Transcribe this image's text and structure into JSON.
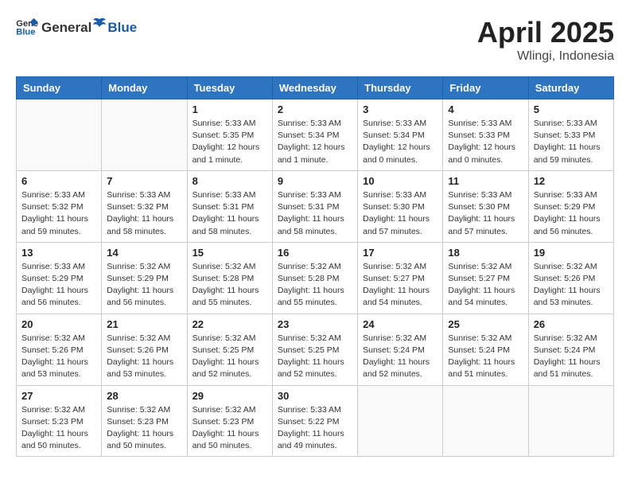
{
  "header": {
    "logo_general": "General",
    "logo_blue": "Blue",
    "title": "April 2025",
    "location": "Wlingi, Indonesia"
  },
  "weekdays": [
    "Sunday",
    "Monday",
    "Tuesday",
    "Wednesday",
    "Thursday",
    "Friday",
    "Saturday"
  ],
  "weeks": [
    [
      {
        "day": "",
        "info": ""
      },
      {
        "day": "",
        "info": ""
      },
      {
        "day": "1",
        "info": "Sunrise: 5:33 AM\nSunset: 5:35 PM\nDaylight: 12 hours\nand 1 minute."
      },
      {
        "day": "2",
        "info": "Sunrise: 5:33 AM\nSunset: 5:34 PM\nDaylight: 12 hours\nand 1 minute."
      },
      {
        "day": "3",
        "info": "Sunrise: 5:33 AM\nSunset: 5:34 PM\nDaylight: 12 hours\nand 0 minutes."
      },
      {
        "day": "4",
        "info": "Sunrise: 5:33 AM\nSunset: 5:33 PM\nDaylight: 12 hours\nand 0 minutes."
      },
      {
        "day": "5",
        "info": "Sunrise: 5:33 AM\nSunset: 5:33 PM\nDaylight: 11 hours\nand 59 minutes."
      }
    ],
    [
      {
        "day": "6",
        "info": "Sunrise: 5:33 AM\nSunset: 5:32 PM\nDaylight: 11 hours\nand 59 minutes."
      },
      {
        "day": "7",
        "info": "Sunrise: 5:33 AM\nSunset: 5:32 PM\nDaylight: 11 hours\nand 58 minutes."
      },
      {
        "day": "8",
        "info": "Sunrise: 5:33 AM\nSunset: 5:31 PM\nDaylight: 11 hours\nand 58 minutes."
      },
      {
        "day": "9",
        "info": "Sunrise: 5:33 AM\nSunset: 5:31 PM\nDaylight: 11 hours\nand 58 minutes."
      },
      {
        "day": "10",
        "info": "Sunrise: 5:33 AM\nSunset: 5:30 PM\nDaylight: 11 hours\nand 57 minutes."
      },
      {
        "day": "11",
        "info": "Sunrise: 5:33 AM\nSunset: 5:30 PM\nDaylight: 11 hours\nand 57 minutes."
      },
      {
        "day": "12",
        "info": "Sunrise: 5:33 AM\nSunset: 5:29 PM\nDaylight: 11 hours\nand 56 minutes."
      }
    ],
    [
      {
        "day": "13",
        "info": "Sunrise: 5:33 AM\nSunset: 5:29 PM\nDaylight: 11 hours\nand 56 minutes."
      },
      {
        "day": "14",
        "info": "Sunrise: 5:32 AM\nSunset: 5:29 PM\nDaylight: 11 hours\nand 56 minutes."
      },
      {
        "day": "15",
        "info": "Sunrise: 5:32 AM\nSunset: 5:28 PM\nDaylight: 11 hours\nand 55 minutes."
      },
      {
        "day": "16",
        "info": "Sunrise: 5:32 AM\nSunset: 5:28 PM\nDaylight: 11 hours\nand 55 minutes."
      },
      {
        "day": "17",
        "info": "Sunrise: 5:32 AM\nSunset: 5:27 PM\nDaylight: 11 hours\nand 54 minutes."
      },
      {
        "day": "18",
        "info": "Sunrise: 5:32 AM\nSunset: 5:27 PM\nDaylight: 11 hours\nand 54 minutes."
      },
      {
        "day": "19",
        "info": "Sunrise: 5:32 AM\nSunset: 5:26 PM\nDaylight: 11 hours\nand 53 minutes."
      }
    ],
    [
      {
        "day": "20",
        "info": "Sunrise: 5:32 AM\nSunset: 5:26 PM\nDaylight: 11 hours\nand 53 minutes."
      },
      {
        "day": "21",
        "info": "Sunrise: 5:32 AM\nSunset: 5:26 PM\nDaylight: 11 hours\nand 53 minutes."
      },
      {
        "day": "22",
        "info": "Sunrise: 5:32 AM\nSunset: 5:25 PM\nDaylight: 11 hours\nand 52 minutes."
      },
      {
        "day": "23",
        "info": "Sunrise: 5:32 AM\nSunset: 5:25 PM\nDaylight: 11 hours\nand 52 minutes."
      },
      {
        "day": "24",
        "info": "Sunrise: 5:32 AM\nSunset: 5:24 PM\nDaylight: 11 hours\nand 52 minutes."
      },
      {
        "day": "25",
        "info": "Sunrise: 5:32 AM\nSunset: 5:24 PM\nDaylight: 11 hours\nand 51 minutes."
      },
      {
        "day": "26",
        "info": "Sunrise: 5:32 AM\nSunset: 5:24 PM\nDaylight: 11 hours\nand 51 minutes."
      }
    ],
    [
      {
        "day": "27",
        "info": "Sunrise: 5:32 AM\nSunset: 5:23 PM\nDaylight: 11 hours\nand 50 minutes."
      },
      {
        "day": "28",
        "info": "Sunrise: 5:32 AM\nSunset: 5:23 PM\nDaylight: 11 hours\nand 50 minutes."
      },
      {
        "day": "29",
        "info": "Sunrise: 5:32 AM\nSunset: 5:23 PM\nDaylight: 11 hours\nand 50 minutes."
      },
      {
        "day": "30",
        "info": "Sunrise: 5:33 AM\nSunset: 5:22 PM\nDaylight: 11 hours\nand 49 minutes."
      },
      {
        "day": "",
        "info": ""
      },
      {
        "day": "",
        "info": ""
      },
      {
        "day": "",
        "info": ""
      }
    ]
  ]
}
